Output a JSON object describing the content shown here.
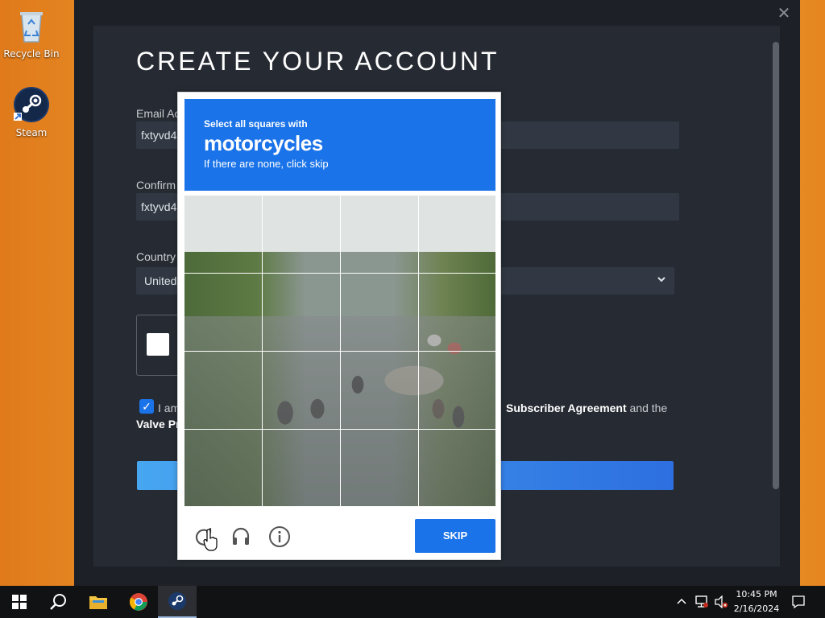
{
  "desktop": {
    "icons": [
      {
        "label": "Recycle Bin",
        "icon": "recycle-bin-icon"
      },
      {
        "label": "Steam",
        "icon": "steam-icon"
      }
    ]
  },
  "window": {
    "close_glyph": "✕"
  },
  "form": {
    "title": "CREATE YOUR ACCOUNT",
    "email_label": "Email Ac",
    "email_value": "fxtyvd4",
    "confirm_label": "Confirm",
    "confirm_value": "fxtyvd4",
    "country_label": "Country",
    "country_value": "United",
    "agree_prefix": "I am",
    "agree_link": "Subscriber Agreement",
    "agree_suffix": "and the",
    "agree_line2": "Valve Pr"
  },
  "captcha": {
    "instruction": "Select all squares with",
    "target": "motorcycles",
    "hint": "If there are none, click skip",
    "skip_label": "SKIP",
    "tiles": [
      "r1c1",
      "r1c2",
      "r1c3",
      "r1c4",
      "r2c1",
      "r2c2",
      "r2c3",
      "r2c4",
      "r3c1",
      "r3c2",
      "r3c3",
      "r3c4",
      "r4c1",
      "r4c2",
      "r4c3",
      "r4c4"
    ]
  },
  "taskbar": {
    "time": "10:45 PM",
    "date": "2/16/2024"
  },
  "colors": {
    "accent": "#1a73e8",
    "window_bg": "#1d2027",
    "panel_bg": "#262b33"
  }
}
